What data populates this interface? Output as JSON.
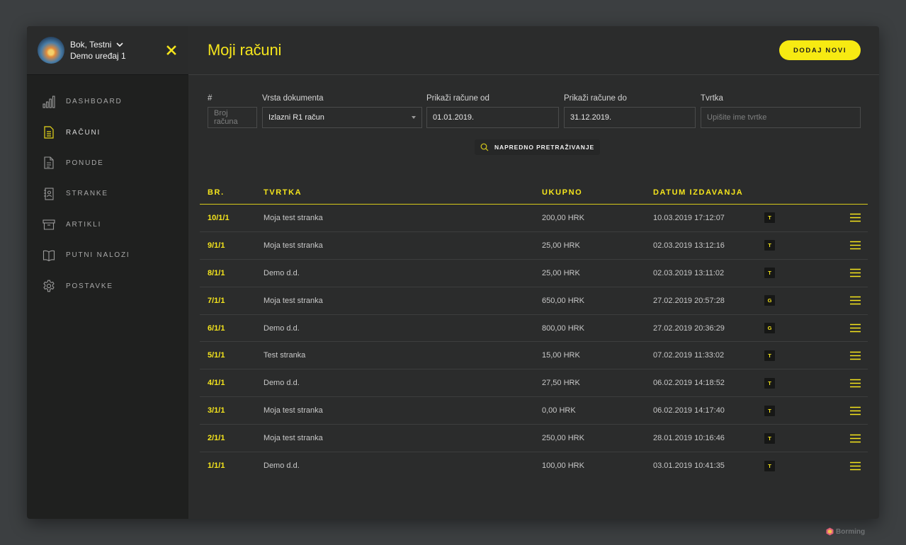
{
  "user": {
    "greeting": "Bok, Testni",
    "device": "Demo uređaj 1"
  },
  "sidebar": {
    "items": [
      {
        "label": "DASHBOARD",
        "icon": "bar-chart-icon"
      },
      {
        "label": "RAČUNI",
        "icon": "invoice-document-icon",
        "active": true
      },
      {
        "label": "PONUDE",
        "icon": "document-icon"
      },
      {
        "label": "STRANKE",
        "icon": "contacts-book-icon"
      },
      {
        "label": "ARTIKLI",
        "icon": "archive-box-icon"
      },
      {
        "label": "PUTNI NALOZI",
        "icon": "open-book-icon"
      },
      {
        "label": "POSTAVKE",
        "icon": "gear-icon"
      }
    ]
  },
  "header": {
    "title": "Moji računi",
    "add_label": "DODAJ NOVI"
  },
  "filters": {
    "number": {
      "label": "#",
      "placeholder": "Broj računa"
    },
    "doc_type": {
      "label": "Vrsta dokumenta",
      "value": "Izlazni R1 račun"
    },
    "date_from": {
      "label": "Prikaži račune od",
      "value": "01.01.2019."
    },
    "date_to": {
      "label": "Prikaži račune do",
      "value": "31.12.2019."
    },
    "company": {
      "label": "Tvrtka",
      "placeholder": "Upišite ime tvrtke"
    },
    "advanced_label": "NAPREDNO PRETRAŽIVANJE"
  },
  "table": {
    "columns": [
      "BR.",
      "TVRTKA",
      "UKUPNO",
      "DATUM IZDAVANJA"
    ],
    "rows": [
      {
        "num": "10/1/1",
        "company": "Moja test stranka",
        "total": "200,00 HRK",
        "date": "10.03.2019 17:12:07",
        "tag": "T"
      },
      {
        "num": "9/1/1",
        "company": "Moja test stranka",
        "total": "25,00 HRK",
        "date": "02.03.2019 13:12:16",
        "tag": "T"
      },
      {
        "num": "8/1/1",
        "company": "Demo d.d.",
        "total": "25,00 HRK",
        "date": "02.03.2019 13:11:02",
        "tag": "T"
      },
      {
        "num": "7/1/1",
        "company": "Moja test stranka",
        "total": "650,00 HRK",
        "date": "27.02.2019 20:57:28",
        "tag": "G"
      },
      {
        "num": "6/1/1",
        "company": "Demo d.d.",
        "total": "800,00 HRK",
        "date": "27.02.2019 20:36:29",
        "tag": "G"
      },
      {
        "num": "5/1/1",
        "company": "Test stranka",
        "total": "15,00 HRK",
        "date": "07.02.2019 11:33:02",
        "tag": "T"
      },
      {
        "num": "4/1/1",
        "company": "Demo d.d.",
        "total": "27,50 HRK",
        "date": "06.02.2019 14:18:52",
        "tag": "T"
      },
      {
        "num": "3/1/1",
        "company": "Moja test stranka",
        "total": "0,00 HRK",
        "date": "06.02.2019 14:17:40",
        "tag": "T"
      },
      {
        "num": "2/1/1",
        "company": "Moja test stranka",
        "total": "250,00 HRK",
        "date": "28.01.2019 10:16:46",
        "tag": "T"
      },
      {
        "num": "1/1/1",
        "company": "Demo d.d.",
        "total": "100,00 HRK",
        "date": "03.01.2019 10:41:35",
        "tag": "T"
      }
    ]
  },
  "watermark": "Borming",
  "colors": {
    "accent": "#f5e51c",
    "sidebar_bg": "#1f201f",
    "main_bg": "#2b2c2c",
    "page_bg": "#3c3f41"
  }
}
